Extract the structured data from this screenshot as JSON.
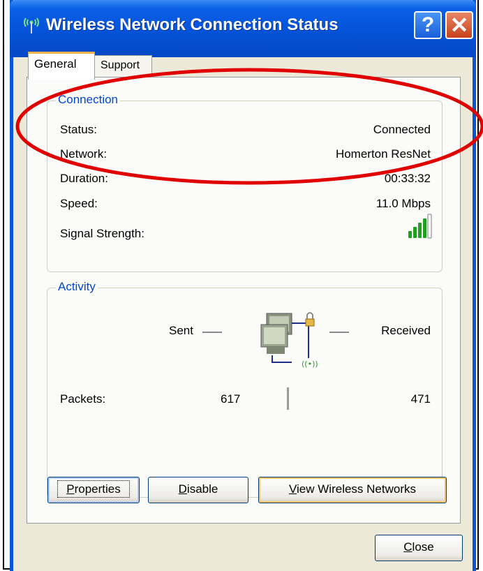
{
  "window": {
    "title": "Wireless Network Connection Status",
    "title_icon": "wireless-antenna-icon",
    "help_glyph": "?",
    "close_glyph": "✕"
  },
  "tabs": [
    {
      "label": "General",
      "selected": true
    },
    {
      "label": "Support",
      "selected": false
    }
  ],
  "connection": {
    "legend": "Connection",
    "rows": [
      {
        "label": "Status:",
        "value": "Connected"
      },
      {
        "label": "Network:",
        "value": "Homerton ResNet"
      },
      {
        "label": "Duration:",
        "value": "00:33:32"
      },
      {
        "label": "Speed:",
        "value": "11.0 Mbps"
      },
      {
        "label": "Signal Strength:",
        "bars_filled": 4,
        "bars_total": 5
      }
    ]
  },
  "activity": {
    "legend": "Activity",
    "sent_label": "Sent",
    "received_label": "Received",
    "packets_label": "Packets:",
    "packets_sent": "617",
    "packets_received": "471",
    "icon": "networked-computers-icon"
  },
  "buttons": {
    "properties": {
      "accel": "P",
      "rest": "roperties"
    },
    "disable": {
      "accel": "D",
      "rest": "isable"
    },
    "view": {
      "accel": "V",
      "rest": "iew Wireless Networks"
    },
    "close": {
      "accel": "C",
      "rest": "lose"
    }
  },
  "colors": {
    "titlebar": "#0553d8",
    "legend": "#0046d5",
    "annotation": "#e00000",
    "signal_bar": "#22a022"
  }
}
